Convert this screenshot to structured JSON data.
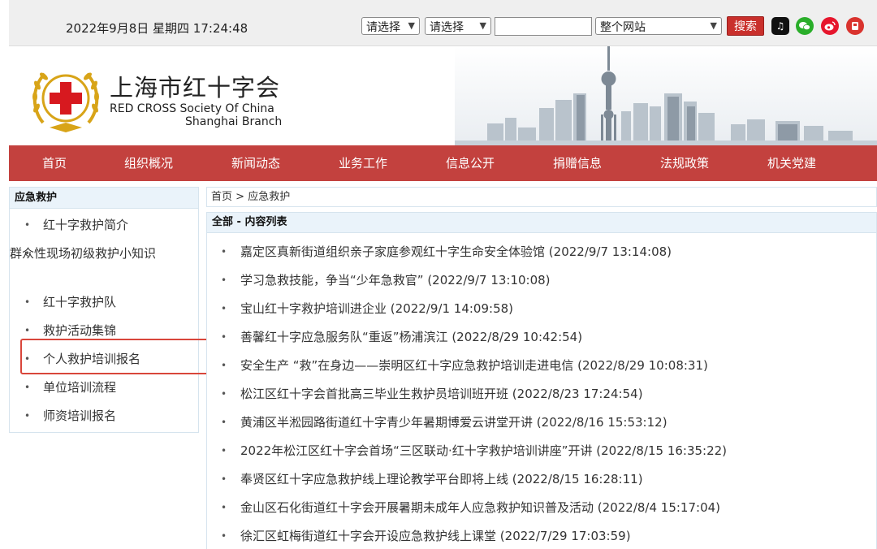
{
  "topbar": {
    "date": "2022年9月8日 星期四 17:24:48",
    "select1": "请选择",
    "select2": "请选择",
    "search_value": "",
    "scope": "整个网站",
    "search_label": "搜索",
    "social_icons": [
      "tiktok-icon",
      "wechat-icon",
      "weibo-icon",
      "app-icon"
    ]
  },
  "header": {
    "name_cn": "上海市红十字会",
    "name_en1": "RED CROSS Society Of China",
    "name_en2": "Shanghai Branch"
  },
  "nav": [
    "首页",
    "组织概况",
    "新闻动态",
    "业务工作",
    "信息公开",
    "捐赠信息",
    "法规政策",
    "机关党建"
  ],
  "sidebar": {
    "title": "应急救护",
    "items": [
      {
        "label": "红十字救护简介"
      },
      {
        "label": "群众性现场初级救护小知识"
      },
      {
        "label": "红十字救护队"
      },
      {
        "label": "救护活动集锦"
      },
      {
        "label": "个人救护培训报名"
      },
      {
        "label": "单位培训流程"
      },
      {
        "label": "师资培训报名"
      }
    ]
  },
  "breadcrumb": {
    "home": "首页",
    "sep": ">",
    "current": "应急救护"
  },
  "list": {
    "title": "全部 - 内容列表",
    "items": [
      {
        "title": "嘉定区真新街道组织亲子家庭参观红十字生命安全体验馆",
        "time": "(2022/9/7 13:14:08)"
      },
      {
        "title": "学习急救技能，争当“少年急救官”",
        "time": "(2022/9/7 13:10:08)"
      },
      {
        "title": "宝山红十字救护培训进企业",
        "time": "(2022/9/1 14:09:58)"
      },
      {
        "title": "善馨红十字应急服务队“重返”杨浦滨江",
        "time": "(2022/8/29 10:42:54)"
      },
      {
        "title": "安全生产 “救”在身边——崇明区红十字应急救护培训走进电信",
        "time": "(2022/8/29 10:08:31)"
      },
      {
        "title": "松江区红十字会首批高三毕业生救护员培训班开班",
        "time": "(2022/8/23 17:24:54)"
      },
      {
        "title": "黄浦区半淞园路街道红十字青少年暑期博爱云讲堂开讲",
        "time": "(2022/8/16 15:53:12)"
      },
      {
        "title": "2022年松江区红十字会首场“三区联动·红十字救护培训讲座”开讲",
        "time": "(2022/8/15 16:35:22)"
      },
      {
        "title": "奉贤区红十字应急救护线上理论教学平台即将上线",
        "time": "(2022/8/15 16:28:11)"
      },
      {
        "title": "金山区石化街道红十字会开展暑期未成年人应急救护知识普及活动",
        "time": "(2022/8/4 15:17:04)"
      },
      {
        "title": "徐汇区虹梅街道红十字会开设应急救护线上课堂",
        "time": "(2022/7/29 17:03:59)"
      }
    ]
  },
  "colors": {
    "nav_bg": "#c3413e",
    "search_btn": "#c9302c",
    "highlight_box": "#d9463b",
    "panel_header": "#eaf3fa"
  }
}
